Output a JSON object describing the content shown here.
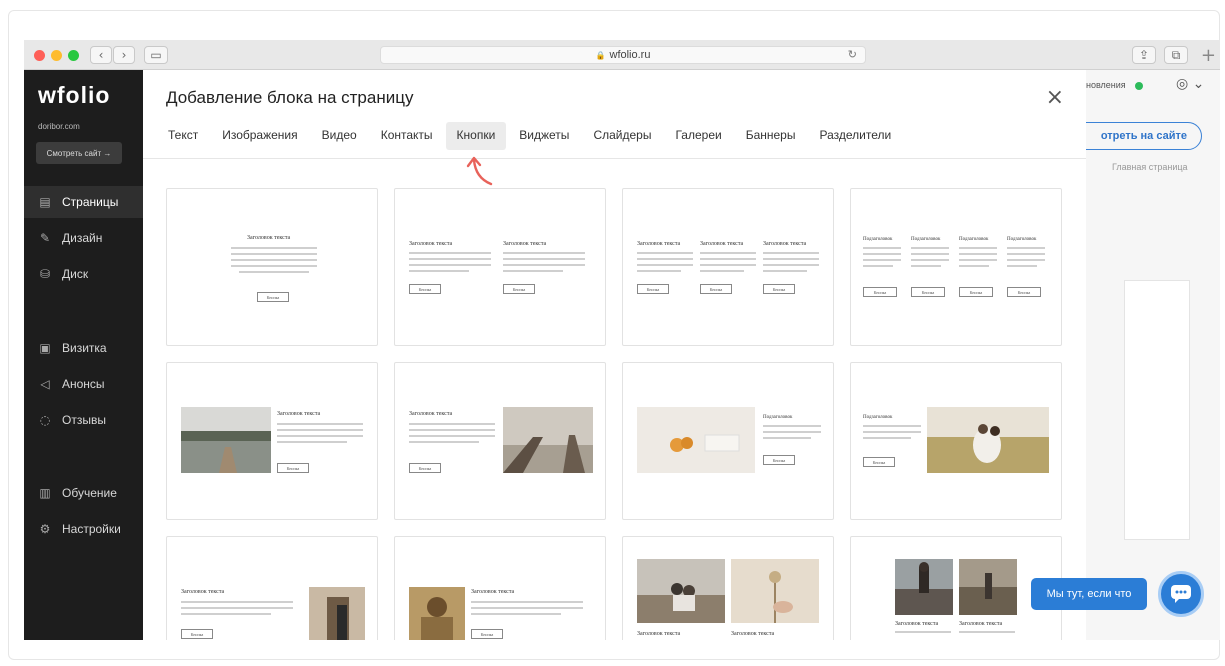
{
  "browser": {
    "url": "wfolio.ru"
  },
  "sidebar": {
    "logo": "wfolio",
    "domain": "doribor.com",
    "site_button": "Смотреть сайт →",
    "items": [
      {
        "label": "Страницы",
        "icon": "page-icon"
      },
      {
        "label": "Дизайн",
        "icon": "brush-icon"
      },
      {
        "label": "Диск",
        "icon": "disk-icon"
      },
      {
        "label": "Визитка",
        "icon": "card-icon"
      },
      {
        "label": "Анонсы",
        "icon": "megaphone-icon"
      },
      {
        "label": "Отзывы",
        "icon": "chat-icon"
      },
      {
        "label": "Обучение",
        "icon": "book-icon"
      },
      {
        "label": "Настройки",
        "icon": "gear-icon"
      }
    ]
  },
  "right": {
    "status": "новления",
    "view_site": "отреть на сайте",
    "main_page": "Главная страница"
  },
  "modal": {
    "title": "Добавление блока на страницу",
    "tabs": [
      "Текст",
      "Изображения",
      "Видео",
      "Контакты",
      "Кнопки",
      "Виджеты",
      "Слайдеры",
      "Галереи",
      "Баннеры",
      "Разделители"
    ],
    "active_tab": "Кнопки",
    "caption": "Заголовок текста",
    "subhead": "Подзаголовок",
    "button": "Кнопка"
  },
  "chat": {
    "bubble": "Мы тут, если что"
  },
  "colors": {
    "accent": "#2b7dd6",
    "sidebar": "#1d1d1d",
    "status_green": "#2dbb5b",
    "arrow": "#e8625a"
  }
}
